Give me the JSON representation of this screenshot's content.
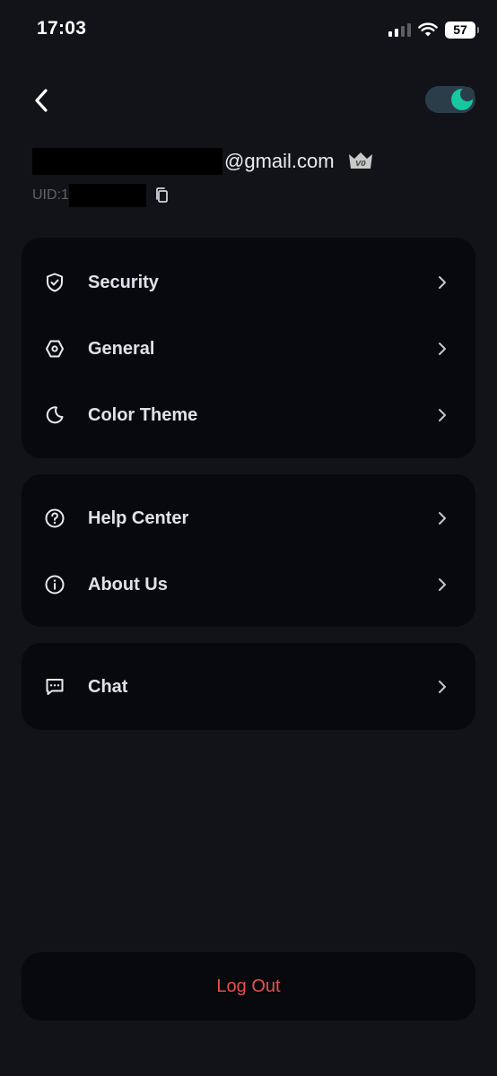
{
  "status_bar": {
    "time": "17:03",
    "battery": "57"
  },
  "header": {
    "back_icon": "chevron-left-icon",
    "theme_toggle_icon": "moon-icon",
    "theme_toggle_color": "#17c7a0"
  },
  "account": {
    "email_domain": "@gmail.com",
    "uid_label": "UID:1",
    "vip_badge": "V0",
    "copy_icon": "copy-icon"
  },
  "menu_groups": [
    {
      "items": [
        {
          "label": "Security",
          "icon": "shield-check-icon"
        },
        {
          "label": "General",
          "icon": "hexagon-settings-icon"
        },
        {
          "label": "Color Theme",
          "icon": "moon-icon"
        }
      ]
    },
    {
      "items": [
        {
          "label": "Help Center",
          "icon": "question-circle-icon"
        },
        {
          "label": "About Us",
          "icon": "info-circle-icon"
        }
      ]
    },
    {
      "items": [
        {
          "label": "Chat",
          "icon": "chat-bubble-icon"
        }
      ]
    }
  ],
  "logout": {
    "label": "Log Out",
    "color": "#e5504f"
  }
}
